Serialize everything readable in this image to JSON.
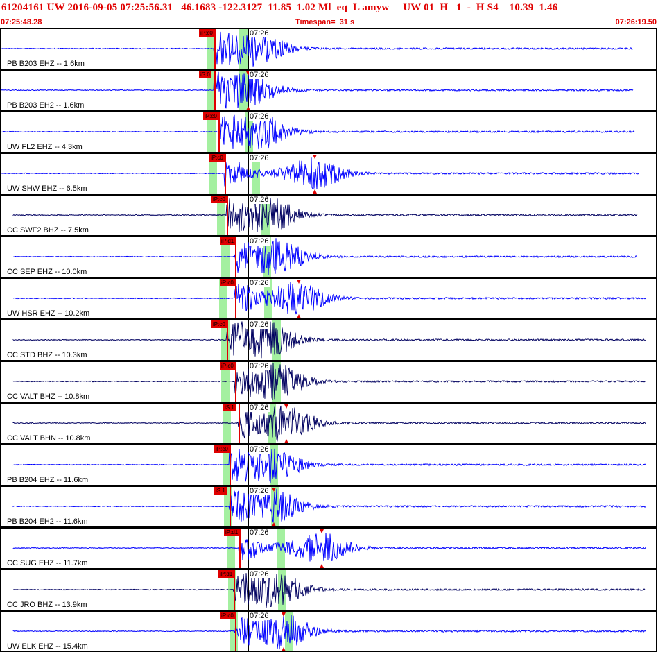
{
  "header": {
    "event_line": "61204161 UW 2016-09-05 07:25:56.31   46.1683 -122.3127  11.85  1.02 Ml  eq  L amyw     UW 01  H   1  -  H S4    10.39  1.46",
    "start_time": "07:25:48.28",
    "timespan": "Timespan=  31 s",
    "end_time": "07:26:19.50"
  },
  "colors": {
    "header_text": "#e00000",
    "pick": "#e00000",
    "trace_blue": "#0000ff",
    "trace_navy": "#000060",
    "window_green": "#a4f0a0"
  },
  "tick_label": "07:26",
  "channels": [
    {
      "label": "PB B203 EHZ -- 1.6km",
      "pick_label": "iP:c0",
      "trace_color": "#0000ff"
    },
    {
      "label": "PB B203 EH2 -- 1.6km",
      "pick_label": "iS 0",
      "trace_color": "#0000ff"
    },
    {
      "label": "UW FL2 EHZ -- 4.3km",
      "pick_label": "iP:c0",
      "trace_color": "#0000ff"
    },
    {
      "label": "UW SHW EHZ -- 6.5km",
      "pick_label": "iP:c0",
      "trace_color": "#0000ff"
    },
    {
      "label": "CC SWF2 BHZ -- 7.5km",
      "pick_label": "iP:c0",
      "trace_color": "#000060"
    },
    {
      "label": "CC SEP EHZ -- 10.0km",
      "pick_label": "iP:d1",
      "trace_color": "#0000ff"
    },
    {
      "label": "UW HSR EHZ -- 10.2km",
      "pick_label": "iP:c0",
      "trace_color": "#0000ff"
    },
    {
      "label": "CC STD BHZ -- 10.3km",
      "pick_label": "iP:c0",
      "trace_color": "#000060"
    },
    {
      "label": "CC VALT BHZ -- 10.8km",
      "pick_label": "iP:c0",
      "trace_color": "#000060"
    },
    {
      "label": "CC VALT BHN -- 10.8km",
      "pick_label": "iS 1",
      "trace_color": "#000060"
    },
    {
      "label": "PB B204 EHZ -- 11.6km",
      "pick_label": "iP:c0",
      "trace_color": "#0000ff"
    },
    {
      "label": "PB B204 EH2 -- 11.6km",
      "pick_label": "iS 1",
      "trace_color": "#0000ff"
    },
    {
      "label": "CC SUG EHZ -- 11.7km",
      "pick_label": "iP:d1",
      "trace_color": "#0000ff"
    },
    {
      "label": "CC JRO BHZ -- 13.9km",
      "pick_label": "iP:d1",
      "trace_color": "#000060"
    },
    {
      "label": "UW ELK EHZ -- 15.4km",
      "pick_label": "iP:c0",
      "trace_color": "#0000ff"
    }
  ]
}
